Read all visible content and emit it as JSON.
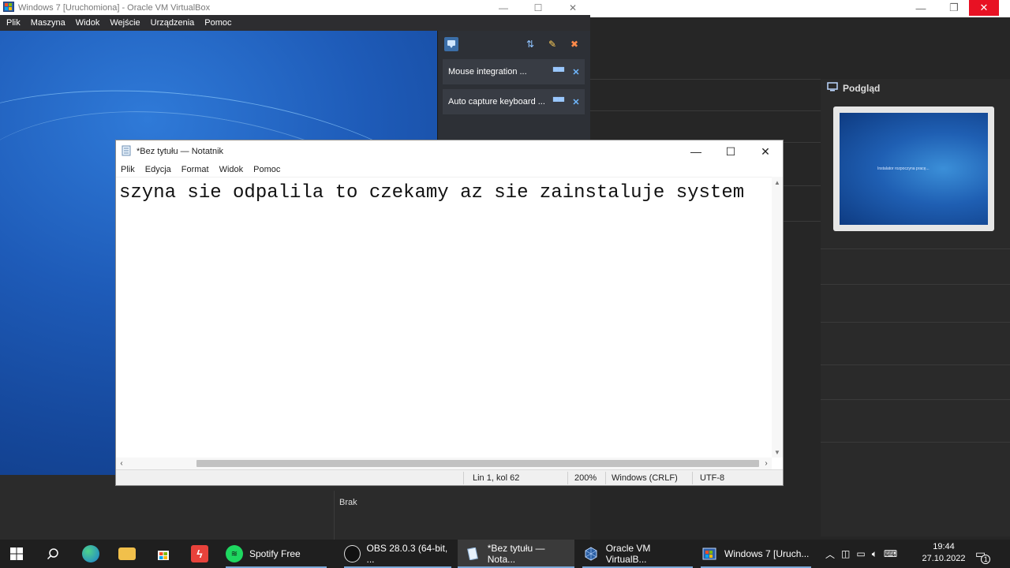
{
  "vbox": {
    "title": "Windows 7 [Uruchomiona] - Oracle VM VirtualBox",
    "menu": [
      "Plik",
      "Maszyna",
      "Widok",
      "Wejście",
      "Urządzenia",
      "Pomoc"
    ],
    "notifications": [
      {
        "text": "Mouse integration ..."
      },
      {
        "text": "Auto capture keyboard ..."
      }
    ]
  },
  "bg_app": {
    "preview_title": "Podgląd",
    "preview_text": "Instalator rozpoczyna pracę...",
    "status": "Brak"
  },
  "notepad": {
    "title": "*Bez tytułu — Notatnik",
    "menu": [
      "Plik",
      "Edycja",
      "Format",
      "Widok",
      "Pomoc"
    ],
    "content": "szyna sie odpalila to czekamy az sie zainstaluje system",
    "status": {
      "position": "Lin 1, kol 62",
      "zoom": "200%",
      "line_ending": "Windows (CRLF)",
      "encoding": "UTF-8"
    }
  },
  "taskbar": {
    "items": [
      {
        "label": "Spotify Free",
        "icon": "spotify-icon"
      },
      {
        "label": "OBS 28.0.3 (64-bit, ...",
        "icon": "obs-icon"
      },
      {
        "label": "*Bez tytułu — Nota...",
        "icon": "notepad-icon",
        "active": true
      },
      {
        "label": "Oracle VM VirtualB...",
        "icon": "virtualbox-icon"
      },
      {
        "label": "Windows 7 [Uruch...",
        "icon": "virtualbox-vm-icon"
      }
    ],
    "clock": {
      "time": "19:44",
      "date": "27.10.2022"
    },
    "notification_count": "1"
  }
}
